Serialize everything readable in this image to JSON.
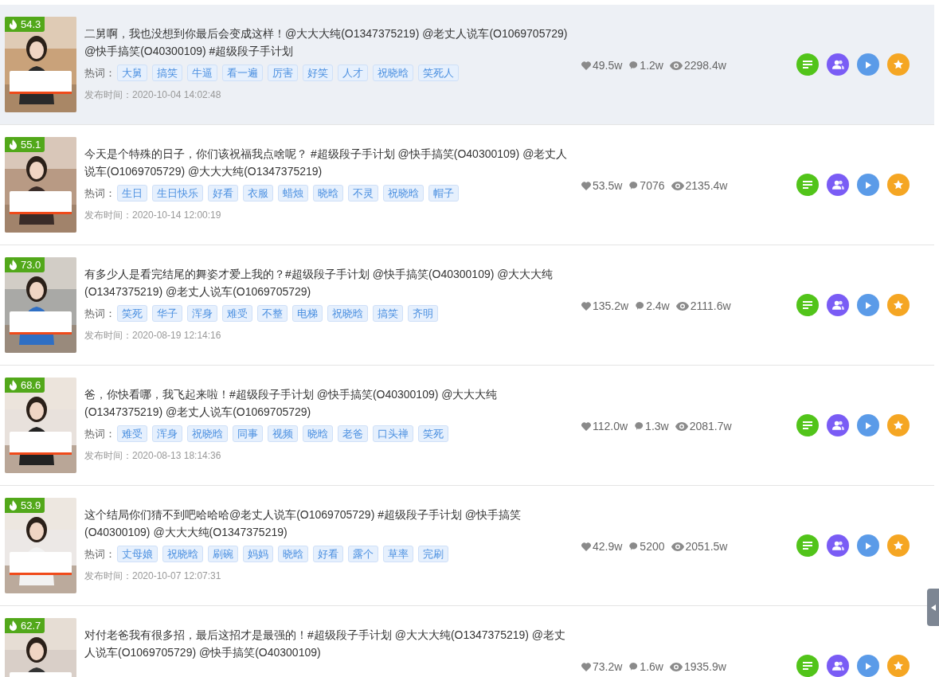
{
  "videos": [
    {
      "highlighted": true,
      "score": "54.3",
      "title": "二舅啊，我也没想到你最后会变成这样！@大大大纯(O1347375219) @老丈人说车(O1069705729) @快手搞笑(O40300109) #超级段子手计划",
      "hot_label": "热词：",
      "tags": [
        "大舅",
        "搞笑",
        "牛逼",
        "看一遍",
        "厉害",
        "好笑",
        "人才",
        "祝晓晗",
        "笑死人"
      ],
      "published": "发布时间：2020-10-04 14:02:48",
      "likes": "49.5w",
      "comments": "1.2w",
      "views": "2298.4w"
    },
    {
      "highlighted": false,
      "score": "55.1",
      "title": "今天是个特殊的日子，你们该祝福我点啥呢？ #超级段子手计划 @快手搞笑(O40300109) @老丈人说车(O1069705729) @大大大纯(O1347375219)",
      "hot_label": "热词：",
      "tags": [
        "生日",
        "生日快乐",
        "好看",
        "衣服",
        "蜡烛",
        "晓晗",
        "不灵",
        "祝晓晗",
        "帽子"
      ],
      "published": "发布时间：2020-10-14 12:00:19",
      "likes": "53.5w",
      "comments": "7076",
      "views": "2135.4w"
    },
    {
      "highlighted": false,
      "score": "73.0",
      "title": "有多少人是看完结尾的舞姿才爱上我的？#超级段子手计划 @快手搞笑(O40300109) @大大大纯(O1347375219) @老丈人说车(O1069705729)",
      "hot_label": "热词：",
      "tags": [
        "笑死",
        "华子",
        "浑身",
        "难受",
        "不整",
        "电梯",
        "祝晓晗",
        "搞笑",
        "齐明"
      ],
      "published": "发布时间：2020-08-19 12:14:16",
      "likes": "135.2w",
      "comments": "2.4w",
      "views": "2111.6w"
    },
    {
      "highlighted": false,
      "score": "68.6",
      "title": "爸，你快看哪，我飞起来啦！#超级段子手计划 @快手搞笑(O40300109) @大大大纯(O1347375219) @老丈人说车(O1069705729)",
      "hot_label": "热词：",
      "tags": [
        "难受",
        "浑身",
        "祝晓晗",
        "同事",
        "视频",
        "晓晗",
        "老爸",
        "口头禅",
        "笑死"
      ],
      "published": "发布时间：2020-08-13 18:14:36",
      "likes": "112.0w",
      "comments": "1.3w",
      "views": "2081.7w"
    },
    {
      "highlighted": false,
      "score": "53.9",
      "title": "这个结局你们猜不到吧哈哈哈@老丈人说车(O1069705729) #超级段子手计划 @快手搞笑(O40300109) @大大大纯(O1347375219)",
      "hot_label": "热词：",
      "tags": [
        "丈母娘",
        "祝晓晗",
        "刷碗",
        "妈妈",
        "晓晗",
        "好看",
        "露个",
        "草率",
        "完刷"
      ],
      "published": "发布时间：2020-10-07 12:07:31",
      "likes": "42.9w",
      "comments": "5200",
      "views": "2051.5w"
    },
    {
      "highlighted": false,
      "score": "62.7",
      "title": "对付老爸我有很多招，最后这招才是最强的！#超级段子手计划 @大大大纯(O1347375219) @老丈人说车(O1069705729) @快手搞笑(O40300109)",
      "likes": "73.2w",
      "comments": "1.6w",
      "views": "1935.9w"
    }
  ]
}
